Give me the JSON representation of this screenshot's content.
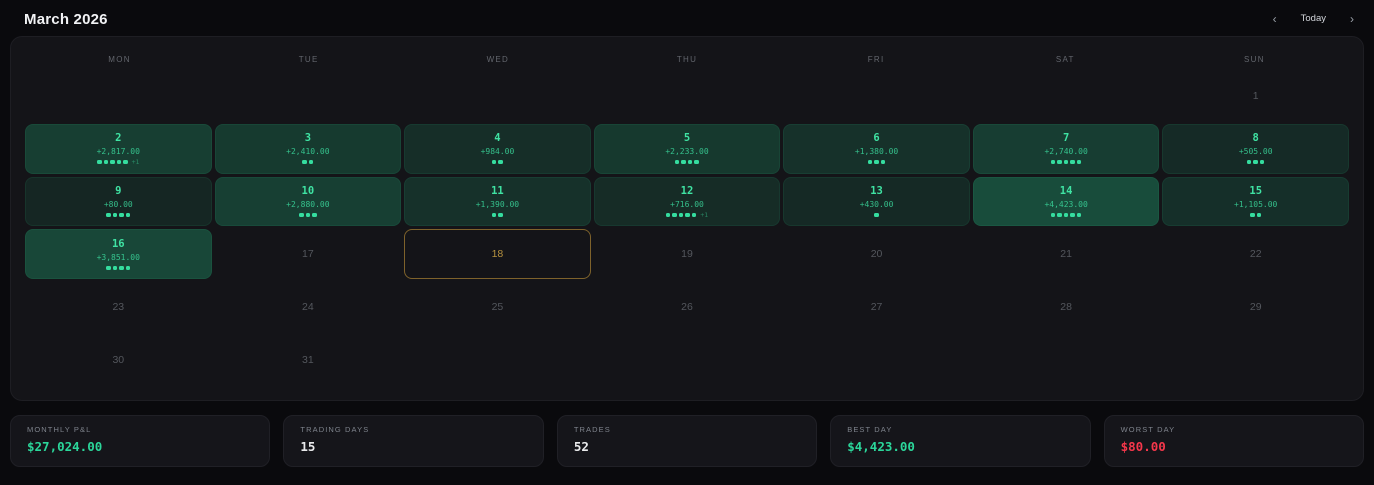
{
  "header": {
    "title": "March 2026",
    "today_label": "Today",
    "prev_icon": "‹",
    "next_icon": "›"
  },
  "calendar": {
    "weekdays": [
      "MON",
      "TUE",
      "WED",
      "THU",
      "FRI",
      "SAT",
      "SUN"
    ],
    "max_pnl": 4423,
    "accent_green": "#35dd9f",
    "today_border": "#c59638",
    "days": [
      {
        "day": 1
      },
      {
        "day": 2,
        "pnl": "+2,817.00",
        "pnl_value": 2817,
        "dots": 5,
        "extra": "+1"
      },
      {
        "day": 3,
        "pnl": "+2,410.00",
        "pnl_value": 2410,
        "dots": 2
      },
      {
        "day": 4,
        "pnl": "+984.00",
        "pnl_value": 984,
        "dots": 2
      },
      {
        "day": 5,
        "pnl": "+2,233.00",
        "pnl_value": 2233,
        "dots": 4
      },
      {
        "day": 6,
        "pnl": "+1,380.00",
        "pnl_value": 1380,
        "dots": 3
      },
      {
        "day": 7,
        "pnl": "+2,740.00",
        "pnl_value": 2740,
        "dots": 5
      },
      {
        "day": 8,
        "pnl": "+505.00",
        "pnl_value": 505,
        "dots": 3
      },
      {
        "day": 9,
        "pnl": "+80.00",
        "pnl_value": 80,
        "dots": 4
      },
      {
        "day": 10,
        "pnl": "+2,880.00",
        "pnl_value": 2880,
        "dots": 3
      },
      {
        "day": 11,
        "pnl": "+1,390.00",
        "pnl_value": 1390,
        "dots": 2
      },
      {
        "day": 12,
        "pnl": "+716.00",
        "pnl_value": 716,
        "dots": 5,
        "extra": "+1"
      },
      {
        "day": 13,
        "pnl": "+430.00",
        "pnl_value": 430,
        "dots": 1
      },
      {
        "day": 14,
        "pnl": "+4,423.00",
        "pnl_value": 4423,
        "dots": 5
      },
      {
        "day": 15,
        "pnl": "+1,105.00",
        "pnl_value": 1105,
        "dots": 2
      },
      {
        "day": 16,
        "pnl": "+3,851.00",
        "pnl_value": 3851,
        "dots": 4
      },
      {
        "day": 17
      },
      {
        "day": 18,
        "today": true
      },
      {
        "day": 19
      },
      {
        "day": 20
      },
      {
        "day": 21
      },
      {
        "day": 22
      },
      {
        "day": 23
      },
      {
        "day": 24
      },
      {
        "day": 25
      },
      {
        "day": 26
      },
      {
        "day": 27
      },
      {
        "day": 28
      },
      {
        "day": 29
      },
      {
        "day": 30
      },
      {
        "day": 31
      }
    ]
  },
  "stats": [
    {
      "label": "MONTHLY P&L",
      "value": "$27,024.00",
      "tone": "green"
    },
    {
      "label": "TRADING DAYS",
      "value": "15",
      "tone": "default"
    },
    {
      "label": "TRADES",
      "value": "52",
      "tone": "default"
    },
    {
      "label": "BEST DAY",
      "value": "$4,423.00",
      "tone": "green"
    },
    {
      "label": "WORST DAY",
      "value": "$80.00",
      "tone": "red"
    }
  ]
}
